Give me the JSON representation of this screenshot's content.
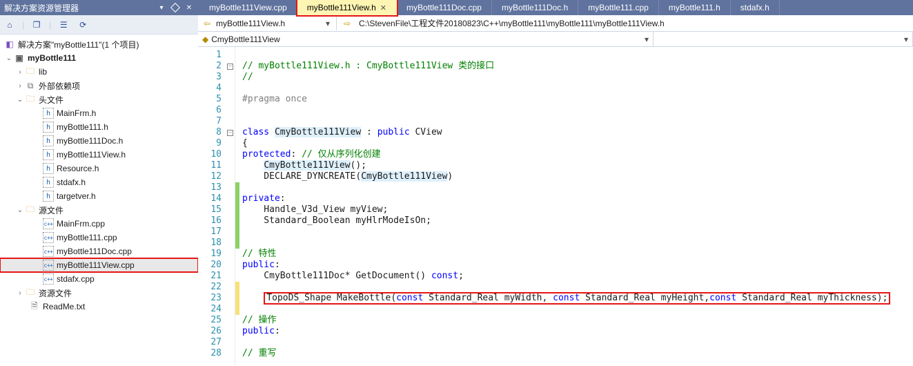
{
  "sidebar": {
    "title": "解决方案资源管理器",
    "solution": "解决方案\"myBottle111\"(1 个项目)",
    "project": "myBottle111",
    "folders": {
      "lib": "lib",
      "ext": "外部依赖项",
      "hdr": "头文件",
      "src": "源文件",
      "res": "资源文件"
    },
    "headers": [
      "MainFrm.h",
      "myBottle111.h",
      "myBottle111Doc.h",
      "myBottle111View.h",
      "Resource.h",
      "stdafx.h",
      "targetver.h"
    ],
    "sources": [
      "MainFrm.cpp",
      "myBottle111.cpp",
      "myBottle111Doc.cpp",
      "myBottle111View.cpp",
      "stdafx.cpp"
    ],
    "readme": "ReadMe.txt"
  },
  "tabs": {
    "items": [
      "myBottle111View.cpp",
      "myBottle111View.h",
      "myBottle111Doc.cpp",
      "myBottle111Doc.h",
      "myBottle111.cpp",
      "myBottle111.h",
      "stdafx.h"
    ],
    "activeIndex": 1
  },
  "nav": {
    "currentFile": "myBottle111View.h",
    "path": "C:\\StevenFile\\工程文件20180823\\C++\\myBottle111\\myBottle111\\myBottle111View.h"
  },
  "membar": {
    "scope": "CmyBottle111View"
  },
  "code": {
    "lines": [
      {
        "n": 1,
        "html": ""
      },
      {
        "n": 2,
        "html": "<span class='c-com'>// myBottle111View.h : CmyBottle111View 类的接口</span>",
        "box": "open"
      },
      {
        "n": 3,
        "html": "<span class='c-com'>//</span>"
      },
      {
        "n": 4,
        "html": ""
      },
      {
        "n": 5,
        "html": "<span class='c-pp'>#pragma</span> <span class='c-pp'>once</span>"
      },
      {
        "n": 6,
        "html": ""
      },
      {
        "n": 7,
        "html": ""
      },
      {
        "n": 8,
        "html": "<span class='c-key'>class</span> <span class='hl-word'>CmyBottle111View</span> : <span class='c-key'>public</span> CView",
        "box": "open"
      },
      {
        "n": 9,
        "html": "{"
      },
      {
        "n": 10,
        "html": "<span class='c-key'>protected</span>: <span class='c-com'>// 仅从序列化创建</span>"
      },
      {
        "n": 11,
        "html": "    <span class='hl-word'>CmyBottle111View</span>();"
      },
      {
        "n": 12,
        "html": "    DECLARE_DYNCREATE(<span class='hl-word'>CmyBottle111View</span>)"
      },
      {
        "n": 13,
        "html": "",
        "track": "g"
      },
      {
        "n": 14,
        "html": "<span class='c-key'>private</span>:",
        "track": "g"
      },
      {
        "n": 15,
        "html": "    Handle_V3d_View myView;",
        "track": "g"
      },
      {
        "n": 16,
        "html": "    Standard_Boolean myHlrModeIsOn;",
        "track": "g"
      },
      {
        "n": 17,
        "html": "",
        "track": "g"
      },
      {
        "n": 18,
        "html": "",
        "track": "g"
      },
      {
        "n": 19,
        "html": "<span class='c-com'>// 特性</span>"
      },
      {
        "n": 20,
        "html": "<span class='c-key'>public</span>:"
      },
      {
        "n": 21,
        "html": "    CmyBottle111Doc* GetDocument() <span class='c-key'>const</span>;"
      },
      {
        "n": 22,
        "html": "",
        "track": "y"
      },
      {
        "n": 23,
        "html": "    <span class='hl-box'>TopoDS_Shape MakeBottle(<span class='c-key'>const</span> Standard_Real myWidth, <span class='c-key'>const</span> Standard_Real myHeight,<span class='c-key'>const</span> Standard_Real myThickness);</span>",
        "track": "y"
      },
      {
        "n": 24,
        "html": "",
        "track": "y"
      },
      {
        "n": 25,
        "html": "<span class='c-com'>// 操作</span>"
      },
      {
        "n": 26,
        "html": "<span class='c-key'>public</span>:"
      },
      {
        "n": 27,
        "html": ""
      },
      {
        "n": 28,
        "html": "<span class='c-com'>// 重写</span>"
      }
    ]
  }
}
